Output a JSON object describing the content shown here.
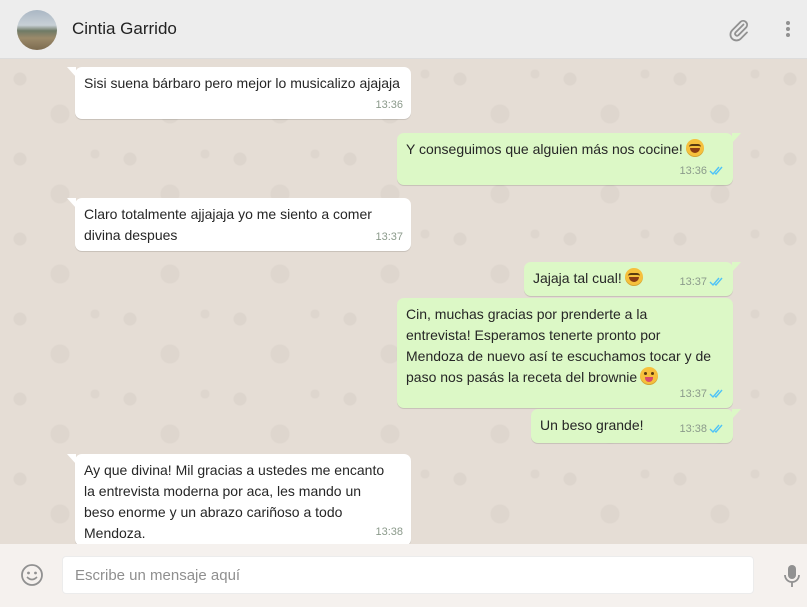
{
  "header": {
    "contact_name": "Cintia Garrido",
    "icons": [
      "avatar",
      "paperclip-icon",
      "menu-dots-icon"
    ]
  },
  "messages": [
    {
      "direction": "incoming",
      "text": "Sisi suena bárbaro pero mejor lo musicalizo ajajaja",
      "time": "13:36"
    },
    {
      "direction": "outgoing",
      "text": "Y conseguimos que alguien más nos cocine!",
      "emoji": "face-with-tears-of-joy",
      "time": "13:36",
      "status": "read"
    },
    {
      "direction": "incoming",
      "lines": [
        "Claro totalmente ajjajaja yo me siento a comer",
        "divina despues"
      ],
      "time": "13:37"
    },
    {
      "direction": "outgoing",
      "text": "Jajaja tal cual!",
      "emoji": "face-with-tears-of-joy",
      "time": "13:37",
      "status": "read"
    },
    {
      "direction": "outgoing",
      "lines": [
        "Cin, muchas gracias por prenderte a la",
        "entrevista! Esperamos tenerte pronto por",
        "Mendoza de nuevo así te escuchamos tocar y de",
        "paso nos pasás la receta del brownie"
      ],
      "emoji": "winking-face-with-tongue",
      "time": "13:37",
      "status": "read"
    },
    {
      "direction": "outgoing",
      "text": "Un beso grande!",
      "time": "13:38",
      "status": "read"
    },
    {
      "direction": "incoming",
      "lines": [
        "Ay que divina! Mil gracias a ustedes me encanto",
        "la entrevista moderna por aca, les mando un",
        "beso enorme y un abrazo cariñoso a todo",
        "Mendoza."
      ],
      "time": "13:38"
    }
  ],
  "composer": {
    "placeholder": "Escribe un mensaje aquí",
    "value": ""
  },
  "colors": {
    "incoming_bubble": "#ffffff",
    "outgoing_bubble": "#dcf8c6",
    "read_ticks": "#4fc3f7",
    "chat_background": "#e5ddd5"
  }
}
